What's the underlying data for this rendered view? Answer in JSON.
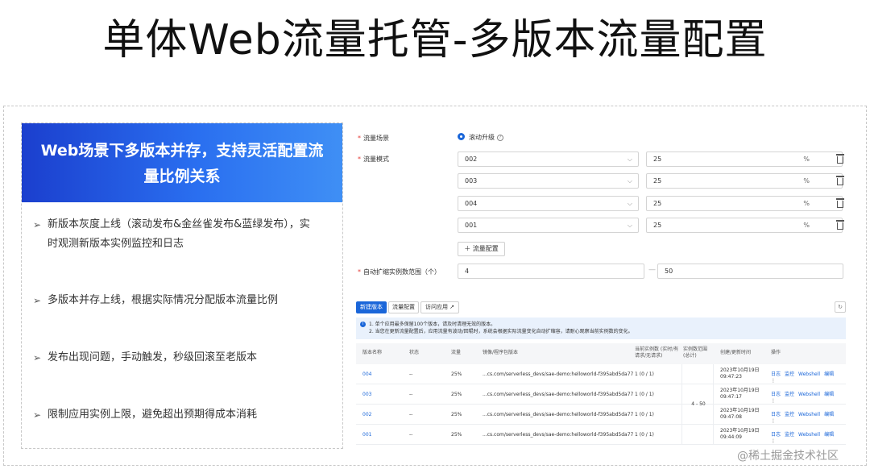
{
  "page_title": "单体Web流量托管-多版本流量配置",
  "left_panel": {
    "heading_line1": "Web场景下多版本并存，支持灵活配置流",
    "heading_line2": "量比例关系",
    "bullets": [
      {
        "line1": "新版本灰度上线（滚动发布&金丝雀发布&蓝绿发布），实",
        "line2": "时观测新版本实例监控和日志"
      },
      {
        "line1": "多版本并存上线，根据实际情况分配版本流量比例",
        "line2": ""
      },
      {
        "line1": "发布出现问题，手动触发，秒级回滚至老版本",
        "line2": ""
      },
      {
        "line1": "限制应用实例上限，避免超出预期得成本消耗",
        "line2": ""
      }
    ],
    "arrow_glyph": "➢"
  },
  "form": {
    "scene_label": "流量场景",
    "scene_value": "滚动升级",
    "mode_label": "流量模式",
    "rows": [
      {
        "version": "002",
        "percent": "25",
        "unit": "%"
      },
      {
        "version": "003",
        "percent": "25",
        "unit": "%"
      },
      {
        "version": "004",
        "percent": "25",
        "unit": "%"
      },
      {
        "version": "001",
        "percent": "25",
        "unit": "%"
      }
    ],
    "add_button": "＋ 流量配置",
    "range_label": "自动扩缩实例数范围（个）",
    "range_min": "4",
    "range_sep": "—",
    "range_max": "50",
    "required_mark": "*"
  },
  "tabs": [
    {
      "label": "新建版本",
      "active": true
    },
    {
      "label": "流量配置",
      "active": false
    },
    {
      "label": "访问应用 ↗",
      "active": false
    }
  ],
  "info": {
    "line1": "1. 单个应用最多保留100个版本，请及时清理无效的版本。",
    "line2": "2. 当您在更新流量配置后，应用流量有波动/回辊时，系统会根据实际流量变化自动扩缩容，请耐心观察当前实例数的变化。"
  },
  "table": {
    "headers": [
      "版本名称",
      "状态",
      "流量",
      "镜像/程序包版本",
      "当前实例数 (实时/有请求/无请求)",
      "实例数范围 (总计)",
      "创建/更新时间",
      "操作"
    ],
    "merged_range": "4 - 50",
    "rows": [
      {
        "name": "004",
        "status": "--",
        "traffic": "25%",
        "image": "...cs.com/serverless_devs/sae-demo:helloworld-f395abd5da77",
        "instances": "1 (0 / 1)",
        "time1": "2023年10月19日",
        "time2": "09:47:23"
      },
      {
        "name": "003",
        "status": "--",
        "traffic": "25%",
        "image": "...cs.com/serverless_devs/sae-demo:helloworld-f395abd5da77",
        "instances": "1 (0 / 1)",
        "time1": "2023年10月19日",
        "time2": "09:47:17"
      },
      {
        "name": "002",
        "status": "--",
        "traffic": "25%",
        "image": "...cs.com/serverless_devs/sae-demo:helloworld-f395abd5da77",
        "instances": "1 (0 / 1)",
        "time1": "2023年10月19日",
        "time2": "09:47:08"
      },
      {
        "name": "001",
        "status": "--",
        "traffic": "25%",
        "image": "...cs.com/serverless_devs/sae-demo:helloworld-f395abd5da77",
        "instances": "1 (0 / 1)",
        "time1": "2023年10月19日",
        "time2": "09:44:09"
      }
    ],
    "ops": [
      "日志",
      "监控",
      "Webshell",
      "编辑",
      "⋮"
    ]
  },
  "watermark": "@稀土掘金技术社区"
}
